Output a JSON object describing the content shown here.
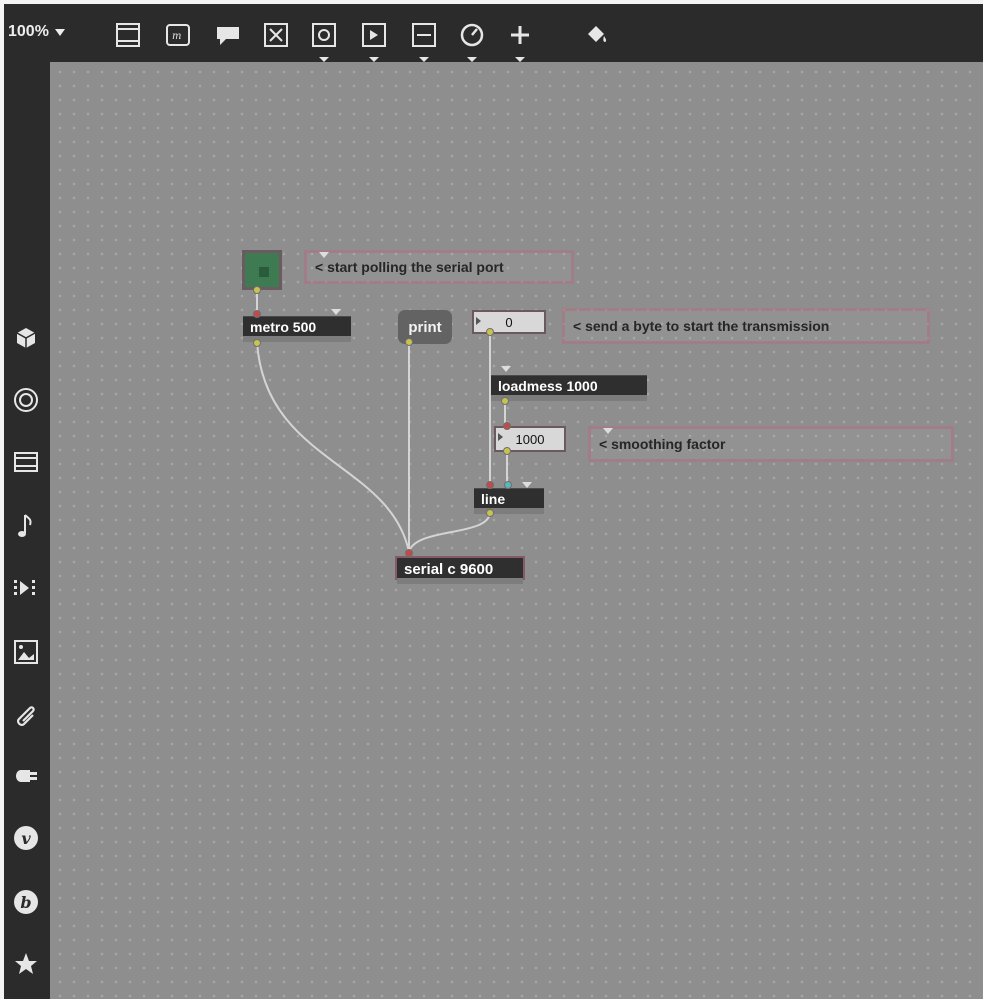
{
  "toolbar": {
    "zoom": "100%",
    "icons": [
      "new-object-icon",
      "message-icon",
      "comment-icon",
      "toggle-icon",
      "bang-icon",
      "number-icon",
      "slider-icon",
      "dial-icon",
      "add-icon",
      "paint-bucket-icon"
    ]
  },
  "sidebar": {
    "icons": [
      "package-icon",
      "target-icon",
      "video-icon",
      "music-note-icon",
      "sequencer-icon",
      "image-icon",
      "paperclip-icon",
      "plug-icon",
      "v-icon",
      "b-icon",
      "star-icon"
    ]
  },
  "patch": {
    "comments": {
      "start_polling": "< start polling the serial port",
      "send_byte": "< send a byte to start the transmission",
      "smoothing": "< smoothing factor"
    },
    "objects": {
      "metro": "metro 500",
      "loadmess": "loadmess 1000",
      "line": "line",
      "serial": "serial c 9600"
    },
    "print_label": "print",
    "number_box_zero": "0",
    "number_box_thousand": "1000"
  },
  "colors": {
    "canvas": "#8e8e8e",
    "toolbar": "#2b2b2b",
    "object_bg": "#2f2f2f",
    "toggle_green": "#3e7a52",
    "comment_border": "#ad6e7d"
  }
}
